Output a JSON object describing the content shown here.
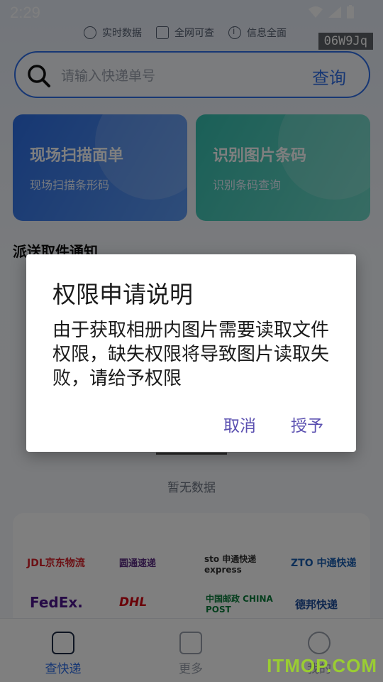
{
  "status_bar": {
    "time": "2:29"
  },
  "features": [
    {
      "label": "实时数据",
      "icon": "chart-circle-icon"
    },
    {
      "label": "全网可查",
      "icon": "scan-square-icon"
    },
    {
      "label": "信息全面",
      "icon": "info-circle-icon"
    }
  ],
  "watermark": "06W9Jq",
  "search": {
    "placeholder": "请输入快递单号",
    "button": "查询"
  },
  "cards": [
    {
      "title": "现场扫描面单",
      "subtitle": "现场扫描条形码"
    },
    {
      "title": "识别图片条码",
      "subtitle": "识别条码查询"
    }
  ],
  "section_title": "派送取件通知",
  "empty_text": "暂无数据",
  "couriers": [
    {
      "name": "JDL京东物流",
      "color": "#d8232a"
    },
    {
      "name": "圆通速递",
      "color": "#5b2c83"
    },
    {
      "name": "sto 申通快递 express",
      "color": "#333333"
    },
    {
      "name": "ZTO 中通快递",
      "color": "#1b5fb0"
    },
    {
      "name": "FedEx.",
      "color": "#4d148c"
    },
    {
      "name": "DHL",
      "color": "#d40511"
    },
    {
      "name": "中国邮政 CHINA POST",
      "color": "#0a7d3b"
    },
    {
      "name": "德邦快递",
      "color": "#1f4e9c"
    }
  ],
  "bottom_nav": [
    {
      "label": "查快递",
      "active": true
    },
    {
      "label": "更多",
      "active": false
    },
    {
      "label": "我的",
      "active": false
    }
  ],
  "site_watermark": "ITMOP.COM",
  "dialog": {
    "title": "权限申请说明",
    "message": "由于获取相册内图片需要读取文件权限，缺失权限将导致图片读取失败，请给予权限",
    "cancel": "取消",
    "confirm": "授予"
  }
}
